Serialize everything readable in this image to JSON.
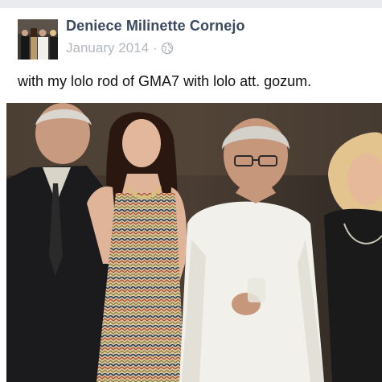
{
  "post": {
    "author": "Deniece Milinette Cornejo",
    "date": "January 2014",
    "separator": "·",
    "privacy_icon": "globe-icon",
    "caption": "with my lolo rod of GMA7 with lolo att. gozum."
  },
  "colors": {
    "author": "#3b4a5f",
    "meta": "#b3b8c0",
    "caption": "#111111",
    "background": "#ffffff",
    "top_edge": "#e9ebee"
  }
}
